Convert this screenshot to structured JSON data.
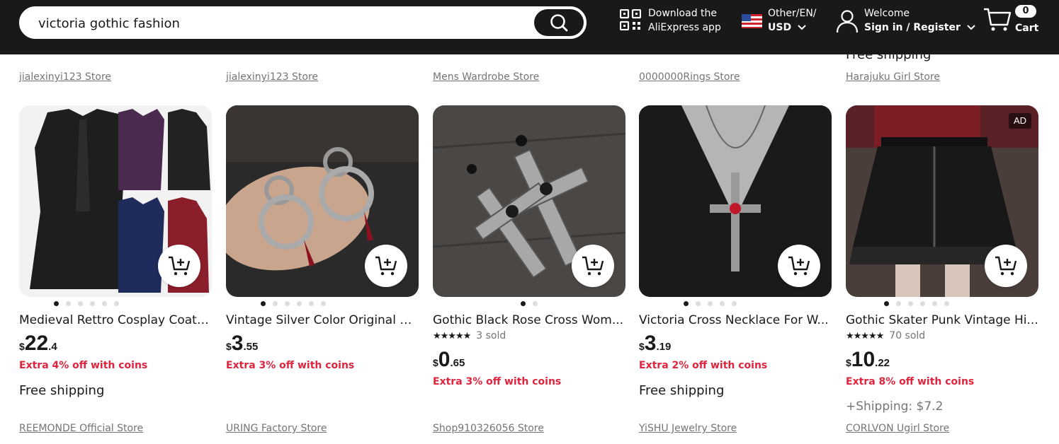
{
  "header": {
    "search": {
      "value": "victoria gothic fashion"
    },
    "app": {
      "line1": "Download the",
      "line2": "AliExpress app"
    },
    "locale": {
      "line1": "Other/EN/",
      "line2": "USD"
    },
    "account": {
      "line1": "Welcome",
      "line2": "Sign in / Register"
    },
    "cart": {
      "count": "0",
      "label": "Cart"
    }
  },
  "previous_row": {
    "free_shipping": "Free shipping",
    "stores": [
      "jialexinyi123 Store",
      "jialexinyi123 Store",
      "Mens Wardrobe Store",
      "0000000Rings Store",
      "Harajuku Girl Store"
    ]
  },
  "products": [
    {
      "title": "Medieval Rettro Cosplay Coat J...",
      "price": {
        "currency": "$",
        "int": "22",
        "dec": ".4"
      },
      "coins": "Extra 4% off with coins",
      "shipping": "Free shipping",
      "store": "REEMONDE Official Store"
    },
    {
      "title": "Vintage Silver Color Original D...",
      "price": {
        "currency": "$",
        "int": "3",
        "dec": ".55"
      },
      "coins": "Extra 3% off with coins",
      "store": "URING Factory Store"
    },
    {
      "title": "Gothic Black Rose Cross Wom...",
      "rating": {
        "stars": "★★★★★",
        "sold": "3 sold"
      },
      "price": {
        "currency": "$",
        "int": "0",
        "dec": ".65"
      },
      "coins": "Extra 3% off with coins",
      "store": "Shop910326056 Store"
    },
    {
      "title": "Victoria Cross Necklace For W...",
      "price": {
        "currency": "$",
        "int": "3",
        "dec": ".19"
      },
      "coins": "Extra 2% off with coins",
      "shipping": "Free shipping",
      "store": "YiSHU Jewelry Store"
    },
    {
      "title": "Gothic Skater Punk Vintage Hi...",
      "rating": {
        "stars": "★★★★★",
        "sold": "70 sold"
      },
      "price": {
        "currency": "$",
        "int": "10",
        "dec": ".22"
      },
      "coins": "Extra 8% off with coins",
      "shipping": "+Shipping: $7.2",
      "store": "CORLVON Ugirl Store",
      "ad": "AD"
    }
  ],
  "icons": {
    "search": "search-icon",
    "qr": "qr-code-icon",
    "flag": "us-flag-icon",
    "user": "user-icon",
    "cart": "cart-icon",
    "add_to_cart": "add-to-cart-icon"
  }
}
